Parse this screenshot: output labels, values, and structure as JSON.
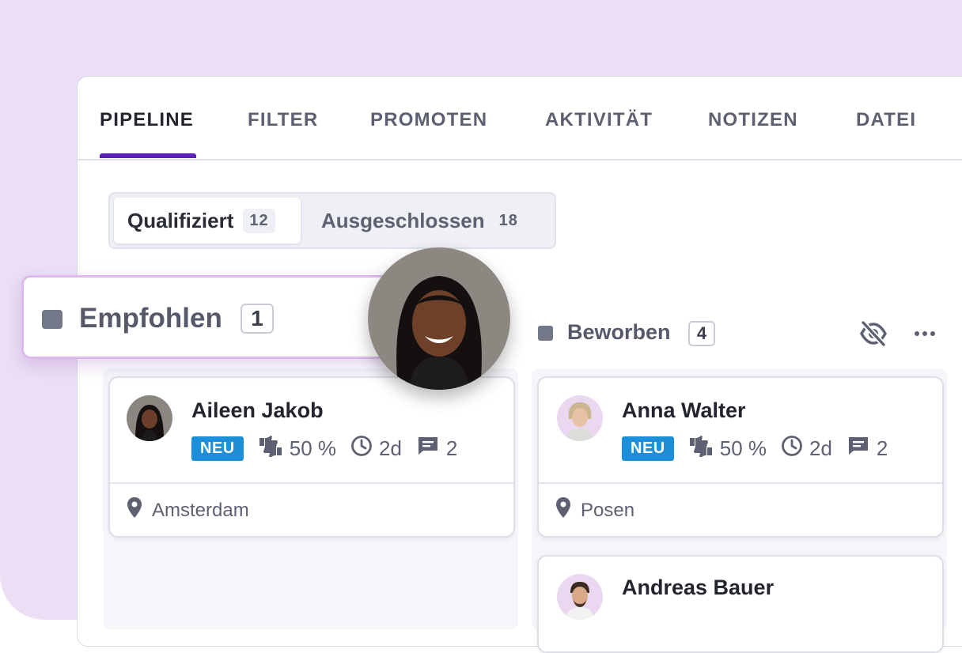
{
  "tabs": [
    {
      "label": "PIPELINE",
      "active": true
    },
    {
      "label": "FILTER"
    },
    {
      "label": "PROMOTEN"
    },
    {
      "label": "AKTIVITÄT"
    },
    {
      "label": "NOTIZEN"
    },
    {
      "label": "DATEI"
    }
  ],
  "segments": [
    {
      "label": "Qualifiziert",
      "count": "12",
      "active": true
    },
    {
      "label": "Ausgeschlossen",
      "count": "18"
    }
  ],
  "columns": [
    {
      "title": "Empfohlen",
      "count": "1",
      "cards": [
        {
          "name": "Aileen Jakob",
          "badge": "NEU",
          "score": "50 %",
          "time": "2d",
          "comments": "2",
          "location": "Amsterdam"
        }
      ]
    },
    {
      "title": "Beworben",
      "count": "4",
      "actions": [
        "eye-off-icon",
        "more-icon"
      ],
      "cards": [
        {
          "name": "Anna Walter",
          "badge": "NEU",
          "score": "50 %",
          "time": "2d",
          "comments": "2",
          "location": "Posen"
        },
        {
          "name": "Andreas Bauer"
        }
      ]
    }
  ],
  "colors": {
    "accent": "#5b21b6",
    "badge": "#1c8fd8",
    "background": "#ecdff5"
  }
}
